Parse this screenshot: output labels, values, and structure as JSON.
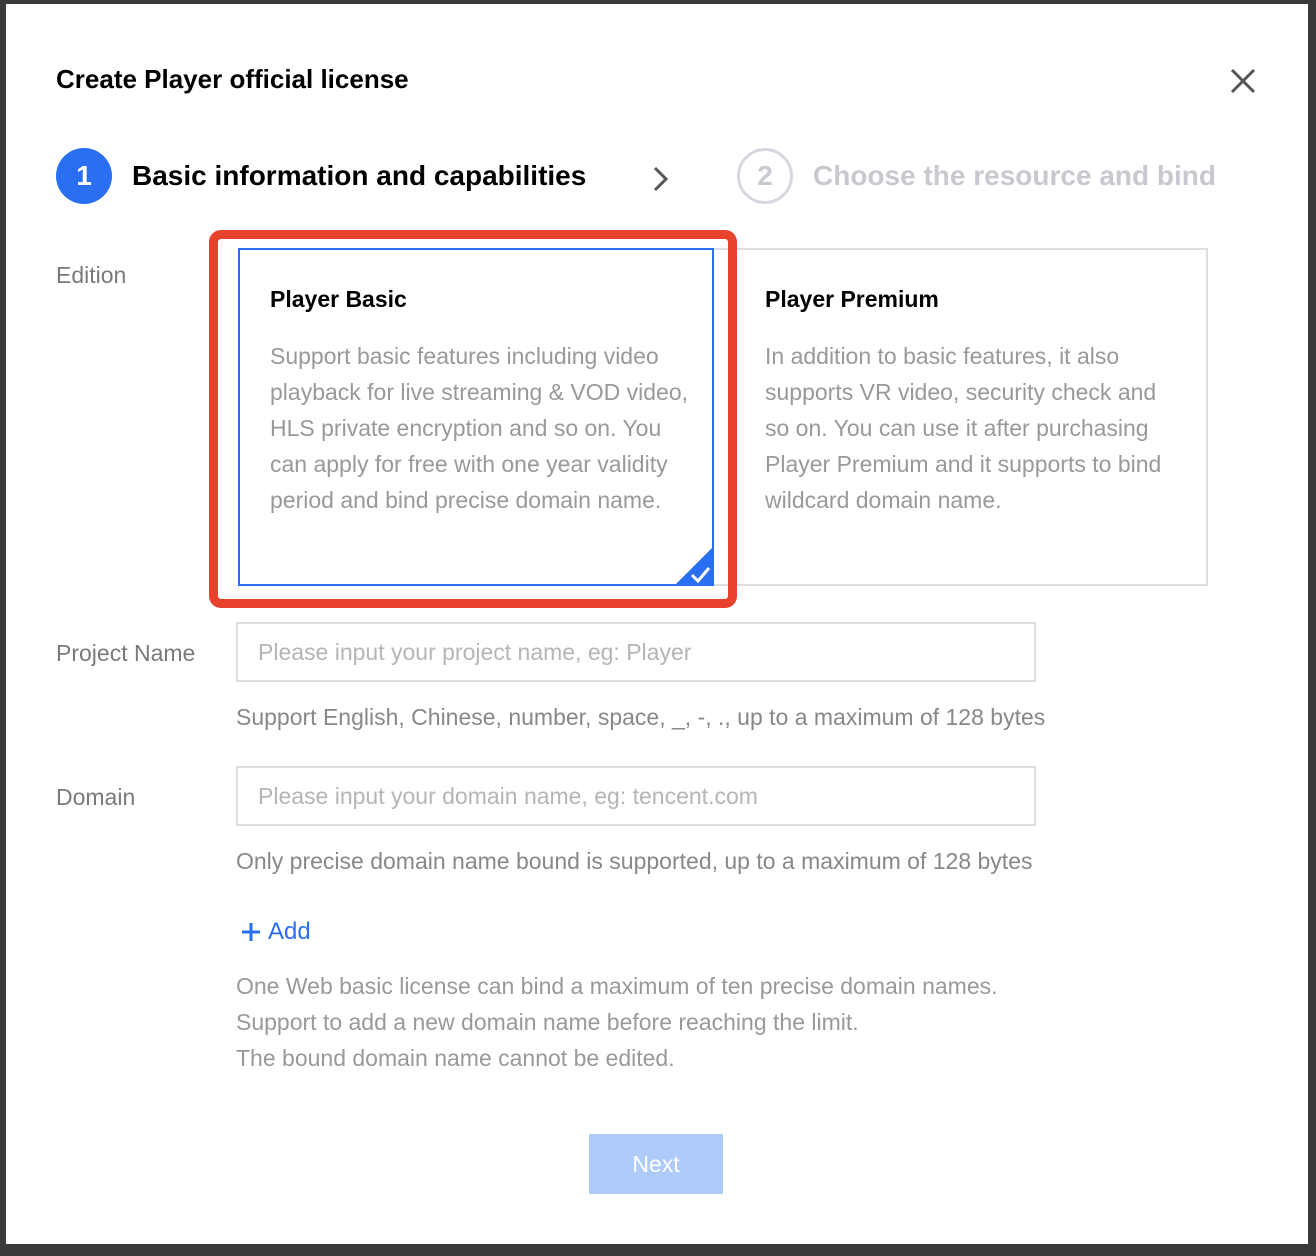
{
  "dialog": {
    "title": "Create Player official license",
    "close_icon": "close-icon"
  },
  "steps": [
    {
      "number": "1",
      "label": "Basic information and capabilities",
      "state": "active"
    },
    {
      "number": "2",
      "label": "Choose the resource and bind",
      "state": "inactive"
    }
  ],
  "edition": {
    "label": "Edition",
    "options": [
      {
        "title": "Player Basic",
        "description": "Support basic features including video playback for live streaming & VOD video, HLS private encryption and so on. You can apply for free with one year validity period and bind precise domain name.",
        "selected": true
      },
      {
        "title": "Player Premium",
        "description": "In addition to basic features, it also supports VR video, security check and so on. You can use it after purchasing Player Premium and it supports to bind wildcard domain name.",
        "selected": false
      }
    ]
  },
  "project_name": {
    "label": "Project Name",
    "value": "",
    "placeholder": "Please input your project name, eg: Player",
    "hint": "Support English, Chinese, number, space, _, -, ., up to a maximum of 128 bytes"
  },
  "domain": {
    "label": "Domain",
    "value": "",
    "placeholder": "Please input your domain name, eg: tencent.com",
    "hint": "Only precise domain name bound is supported, up to a maximum of 128 bytes",
    "add_label": "Add",
    "notes": [
      "One Web basic license can bind a maximum of ten precise domain names.",
      "Support to add a new domain name before reaching the limit.",
      "The bound domain name cannot be edited."
    ]
  },
  "footer": {
    "next_label": "Next"
  },
  "colors": {
    "primary": "#2a6ff2",
    "highlight": "#e8412c",
    "disabled_button": "#aecbfb"
  }
}
